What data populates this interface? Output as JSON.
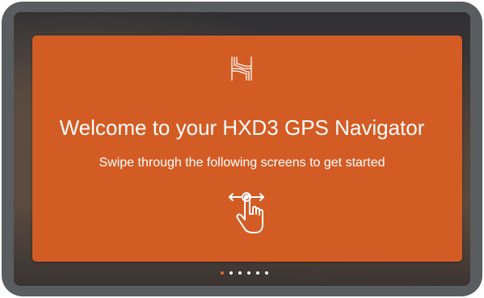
{
  "welcome": {
    "title": "Welcome to your HXD3 GPS Navigator",
    "subtitle": "Swipe through the following screens to get started",
    "logo_icon": "hema-h-logo-icon",
    "gesture_icon": "swipe-hand-icon"
  },
  "pager": {
    "total_pages": 6,
    "current_page": 1
  },
  "colors": {
    "device_bezel": "#595d60",
    "card_background": "#d35c24",
    "active_dot": "#e8692c",
    "inactive_dot": "#ffffff",
    "text": "#ffffff"
  }
}
